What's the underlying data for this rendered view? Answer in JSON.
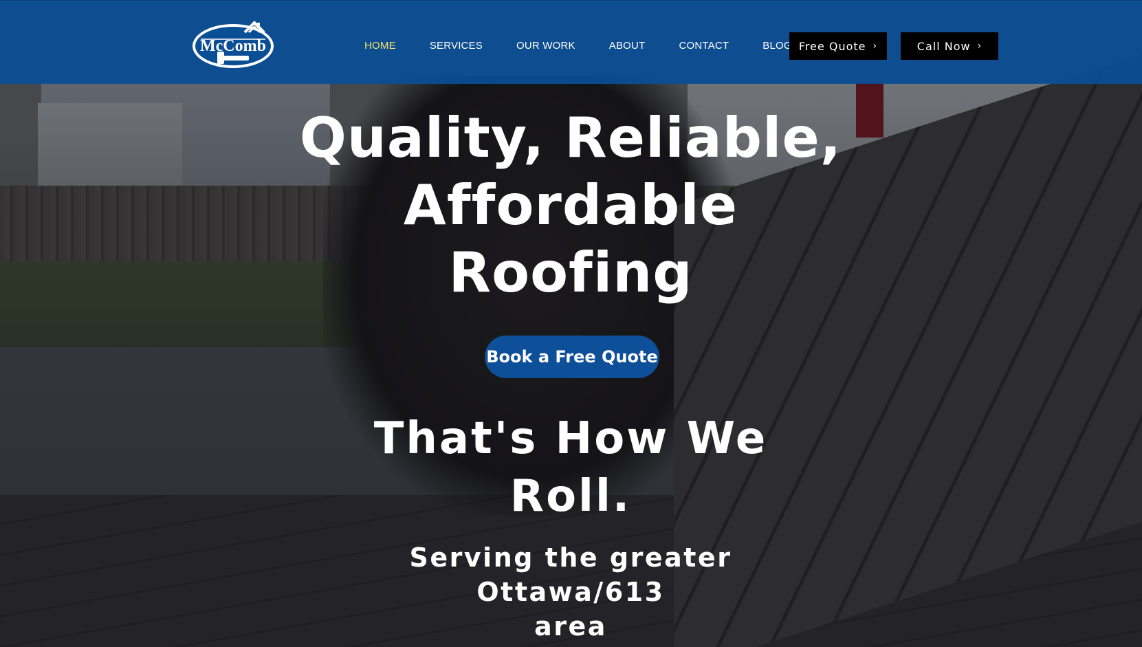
{
  "logo": {
    "text": "McComb"
  },
  "nav": {
    "items": [
      {
        "label": "HOME",
        "active": true
      },
      {
        "label": "SERVICES",
        "active": false
      },
      {
        "label": "OUR WORK",
        "active": false
      },
      {
        "label": "ABOUT",
        "active": false
      },
      {
        "label": "CONTACT",
        "active": false
      },
      {
        "label": "BLOG",
        "active": false
      }
    ],
    "active_color": "#f2e36a"
  },
  "header_buttons": {
    "free_quote": "Free Quote",
    "call_now": "Call Now",
    "icon": "chevron-right-icon"
  },
  "hero": {
    "title_line1": "Quality, Reliable,",
    "title_line2": "Affordable",
    "title_line3": "Roofing",
    "cta": "Book a Free Quote",
    "tagline_line1": "That's How We",
    "tagline_line2": "Roll.",
    "sub_line1": "Serving the greater Ottawa/613",
    "sub_line2": "area"
  },
  "colors": {
    "header_bg": "#0a4e96",
    "cta_bg": "#0d4f98",
    "button_dark": "#000000",
    "text": "#ffffff"
  }
}
